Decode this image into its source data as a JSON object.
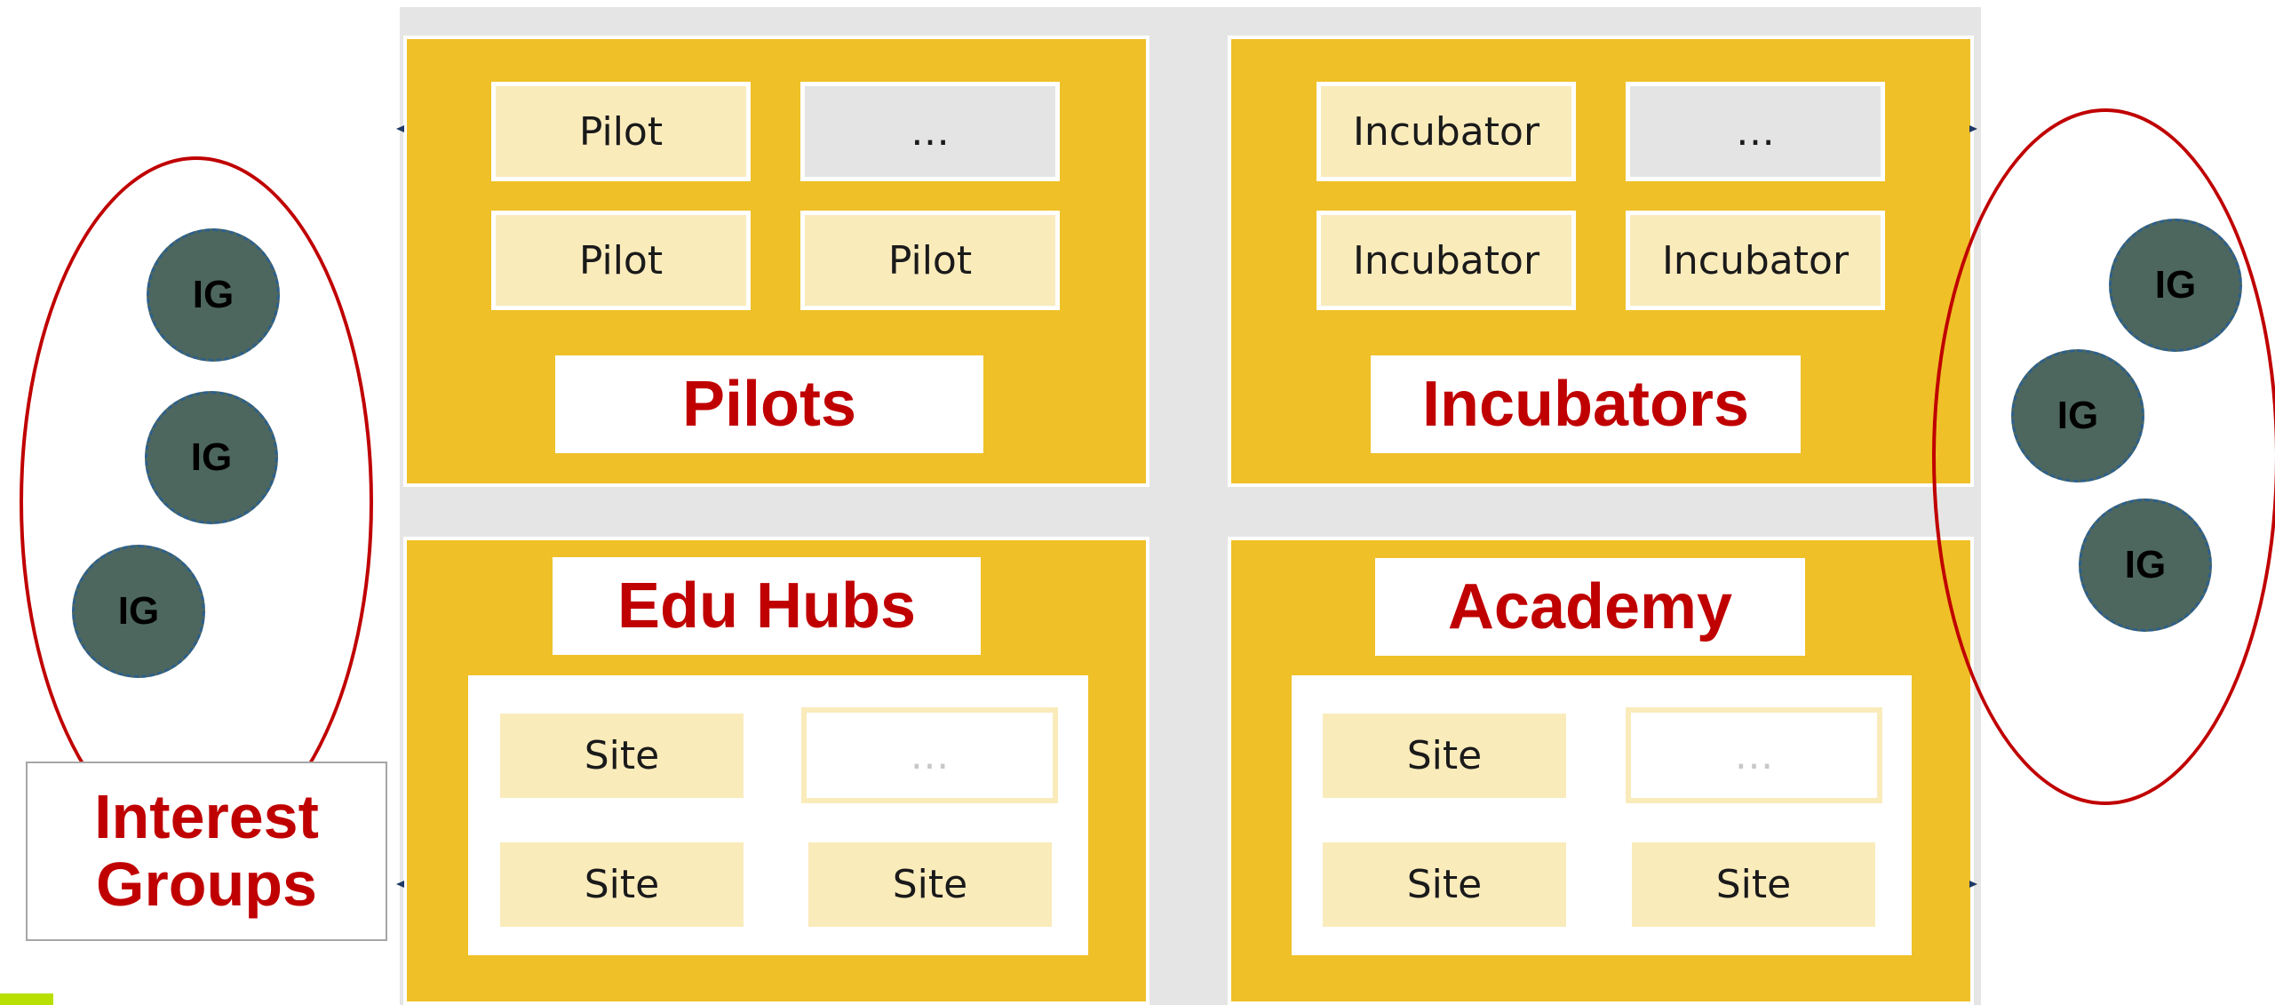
{
  "pilots": {
    "title": "Pilots",
    "items": [
      "Pilot",
      "…",
      "Pilot",
      "Pilot"
    ]
  },
  "incubators": {
    "title": "Incubators",
    "items": [
      "Incubator",
      "…",
      "Incubator",
      "Incubator"
    ]
  },
  "edu_hubs": {
    "title": "Edu Hubs",
    "sites": [
      "Site",
      "…",
      "Site",
      "Site"
    ]
  },
  "academy": {
    "title": "Academy",
    "sites": [
      "Site",
      "…",
      "Site",
      "Site"
    ]
  },
  "interest_groups": {
    "label_line1": "Interest",
    "label_line2": "Groups",
    "node_label": "IG",
    "left_nodes": [
      "IG",
      "IG",
      "IG"
    ],
    "right_nodes": [
      "IG",
      "IG",
      "IG"
    ]
  },
  "colors": {
    "panel": "#efc028",
    "item_light": "#faebbb",
    "item_gray": "#e4e4e4",
    "title_text": "#c00000",
    "ig_node": "#4d675f",
    "ellipse": "#c00000",
    "backdrop": "#e5e5e5"
  }
}
